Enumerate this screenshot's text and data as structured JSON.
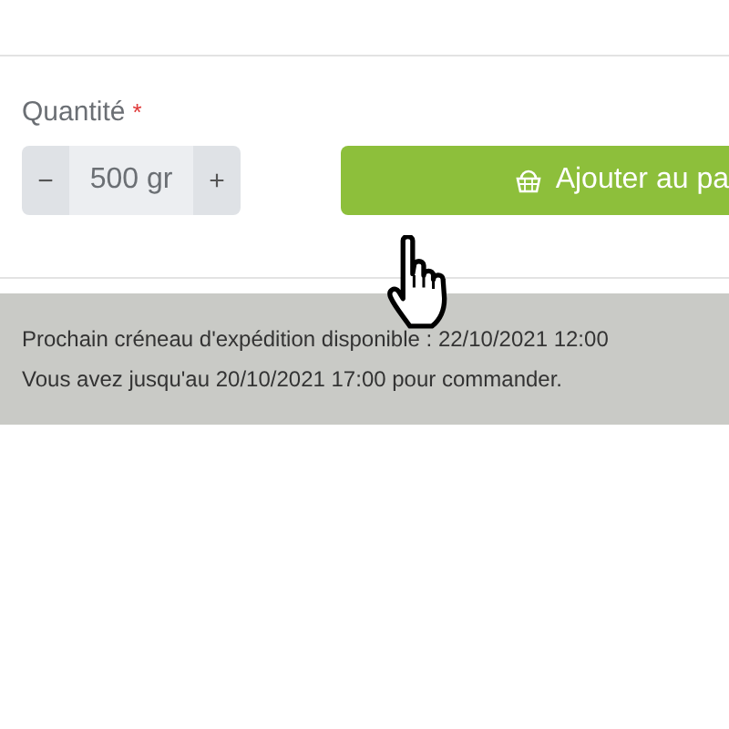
{
  "quantity": {
    "label": "Quantité",
    "required_mark": "*",
    "decrement": "−",
    "value": "500 gr",
    "increment": "+"
  },
  "add_button": {
    "label": "Ajouter au pa"
  },
  "shipping_notice": {
    "lines": [
      "Prochain créneau d'expédition disponible : 22/10/2021 12:00",
      "Vous avez jusqu'au 20/10/2021 17:00 pour commander."
    ]
  }
}
